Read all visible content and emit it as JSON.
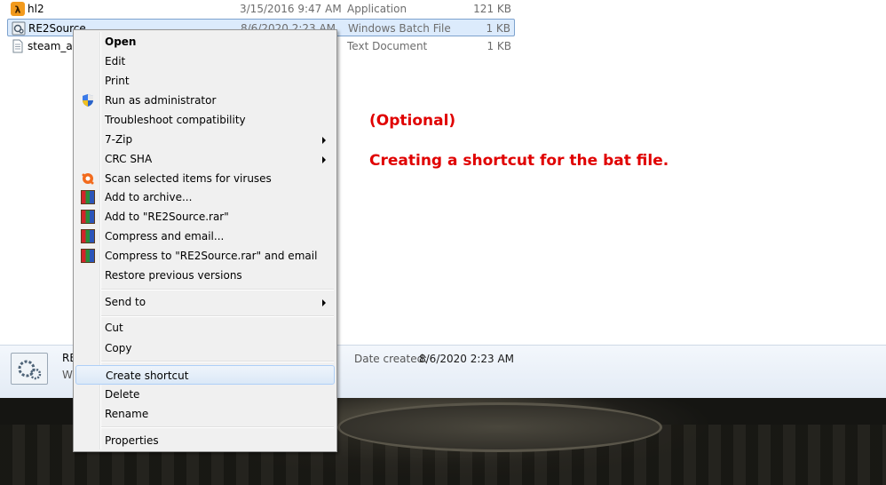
{
  "files": [
    {
      "name": "hl2",
      "date": "3/15/2016 9:47 AM",
      "type": "Application",
      "size": "121 KB",
      "icon": "half-life-icon"
    },
    {
      "name": "RE2Source",
      "date": "8/6/2020 2:23 AM",
      "type": "Windows Batch File",
      "size": "1 KB",
      "icon": "batch-file-icon"
    },
    {
      "name": "steam_ap",
      "date": "",
      "type": "Text Document",
      "size": "1 KB",
      "icon": "text-document-icon"
    }
  ],
  "annotation": {
    "line1": "(Optional)",
    "line2": "Creating a shortcut for the bat file."
  },
  "details": {
    "name": "RE",
    "type": "W",
    "date_label": "Date created:",
    "date_value": "8/6/2020 2:23 AM"
  },
  "menu": {
    "open": "Open",
    "edit": "Edit",
    "print": "Print",
    "run_as_admin": "Run as administrator",
    "troubleshoot": "Troubleshoot compatibility",
    "seven_zip": "7-Zip",
    "crc_sha": "CRC SHA",
    "scan": "Scan selected items for viruses",
    "add_archive": "Add to archive...",
    "add_rar": "Add to \"RE2Source.rar\"",
    "compress_email": "Compress and email...",
    "compress_rar_email": "Compress to \"RE2Source.rar\" and email",
    "restore": "Restore previous versions",
    "send_to": "Send to",
    "cut": "Cut",
    "copy": "Copy",
    "create_shortcut": "Create shortcut",
    "delete": "Delete",
    "rename": "Rename",
    "properties": "Properties"
  },
  "colors": {
    "annotation": "#e00000",
    "selection": "#dcebfc",
    "menu_bg": "#f0f0f0"
  }
}
